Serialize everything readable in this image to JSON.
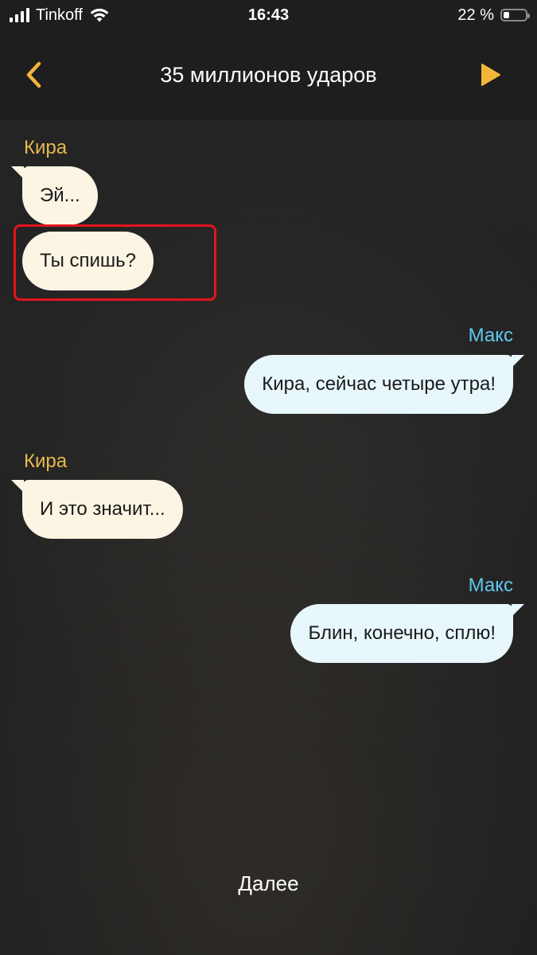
{
  "status_bar": {
    "carrier": "Tinkoff",
    "time": "16:43",
    "battery_text": "22 %",
    "battery_level": 0.22
  },
  "header": {
    "title": "35 миллионов ударов",
    "accent_color": "#f2b63a"
  },
  "messages": [
    {
      "sender": "Кира",
      "text": "Эй..."
    },
    {
      "sender": "",
      "text": "Ты спишь?"
    },
    {
      "sender": "Макс",
      "text": "Кира, сейчас четыре утра!"
    },
    {
      "sender": "Кира",
      "text": "И это значит..."
    },
    {
      "sender": "Макс",
      "text": "Блин, конечно, сплю!"
    }
  ],
  "colors": {
    "kira_name": "#e9b94e",
    "maks_name": "#5ec8ee",
    "kira_bubble": "#fdf5e3",
    "maks_bubble": "#e7f7fc",
    "highlight": "#e3141c"
  },
  "footer": {
    "next_label": "Далее"
  },
  "icons": {
    "back": "chevron-left-icon",
    "play": "play-icon",
    "wifi": "wifi-icon",
    "signal": "signal-icon",
    "battery": "battery-icon"
  }
}
